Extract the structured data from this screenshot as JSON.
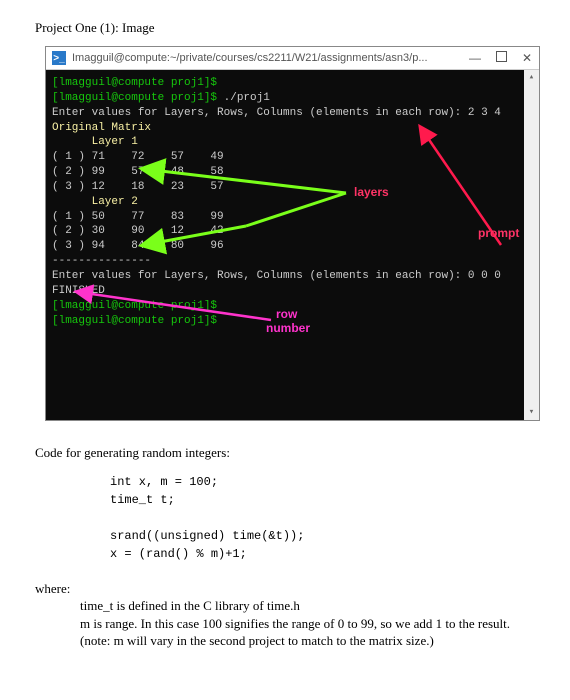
{
  "heading": "Project One (1): Image",
  "window": {
    "icon_glyph": ">_",
    "title": "Imagguil@compute:~/private/courses/cs2211/W21/assignments/asn3/p...",
    "min": "—",
    "close": "✕"
  },
  "terminal": {
    "prompt1": "[lmagguil@compute proj1]$",
    "prompt2": "[lmagguil@compute proj1]$ ./proj1",
    "empty": "",
    "enter_prompt": "Enter values for Layers, Rows, Columns (elements in each row): 2 3 4",
    "orig": "Original Matrix",
    "layer1": "      Layer 1",
    "l1r1": "( 1 ) 71    72    57    49",
    "l1r2": "( 2 ) 99    57    48    58",
    "l1r3": "( 3 ) 12    18    23    57",
    "layer2": "      Layer 2",
    "l2r1": "( 1 ) 50    77    83    99",
    "l2r2": "( 2 ) 30    90    12    42",
    "l2r3": "( 3 ) 94    84    80    96",
    "dots": "---------------",
    "enter_prompt2": "Enter values for Layers, Rows, Columns (elements in each row): 0 0 0",
    "finished": "FINISHED",
    "prompt3": "[lmagguil@compute proj1]$",
    "prompt4": "[lmagguil@compute proj1]$"
  },
  "annotations": {
    "layers": "layers",
    "prompt": "prompt",
    "row1": "row",
    "row2": "number"
  },
  "section2": "Code for generating random integers:",
  "code1": "int x, m = 100;",
  "code2": "time_t t;",
  "code3": "srand((unsigned) time(&t));",
  "code4": "x = (rand() % m)+1;",
  "where_label": "where:",
  "where1": "time_t is defined in the C library of time.h",
  "where2": "m is range. In this case 100 signifies the range of 0 to 99, so we add 1 to the result.",
  "where3": "(note: m will vary in the second project to match to the matrix size.)"
}
